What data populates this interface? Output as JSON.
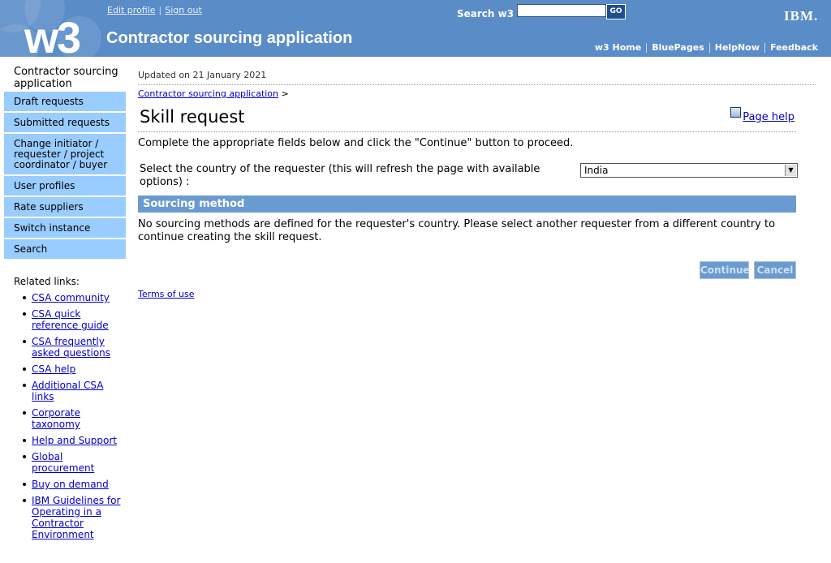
{
  "header": {
    "logo_text": "w3",
    "app_title": "Contractor sourcing application",
    "user_links": {
      "edit_profile": "Edit profile",
      "sign_out": "Sign out"
    },
    "search": {
      "label": "Search w3",
      "value": "",
      "button": "GO"
    },
    "brand": "IBM.",
    "nav": [
      "w3 Home",
      "BluePages",
      "HelpNow",
      "Feedback"
    ],
    "colors": {
      "banner": "#5a8cc8",
      "nav_item": "#99ccff",
      "section_bar": "#6a9bd0"
    }
  },
  "sidebar": {
    "title": "Contractor sourcing application",
    "items": [
      "Draft requests",
      "Submitted requests",
      "Change initiator / requester / project coordinator / buyer",
      "User profiles",
      "Rate suppliers",
      "Switch instance",
      "Search"
    ],
    "related_label": "Related links:",
    "related_links": [
      "CSA community",
      "CSA quick reference guide",
      "CSA frequently asked questions",
      "CSA help",
      "Additional CSA links",
      "Corporate taxonomy",
      "Help and Support",
      "Global procurement",
      "Buy on demand",
      "IBM Guidelines for Operating in a Contractor Environment"
    ]
  },
  "main": {
    "updated": "Updated on 21 January 2021",
    "breadcrumb": {
      "link": "Contractor sourcing application",
      "separator": ">"
    },
    "title": "Skill request",
    "page_help": "Page help",
    "instructions": "Complete the appropriate fields below and click the \"Continue\" button to proceed.",
    "country_label": "Select the country of the requester (this will refresh the page with available options) :",
    "country_value": "India",
    "section_title": "Sourcing method",
    "no_methods_text": "No sourcing methods are defined for the requester's country. Please select another requester from a different country to continue creating the skill request.",
    "continue_label": "Continue",
    "cancel_label": "Cancel",
    "terms": "Terms of use"
  }
}
